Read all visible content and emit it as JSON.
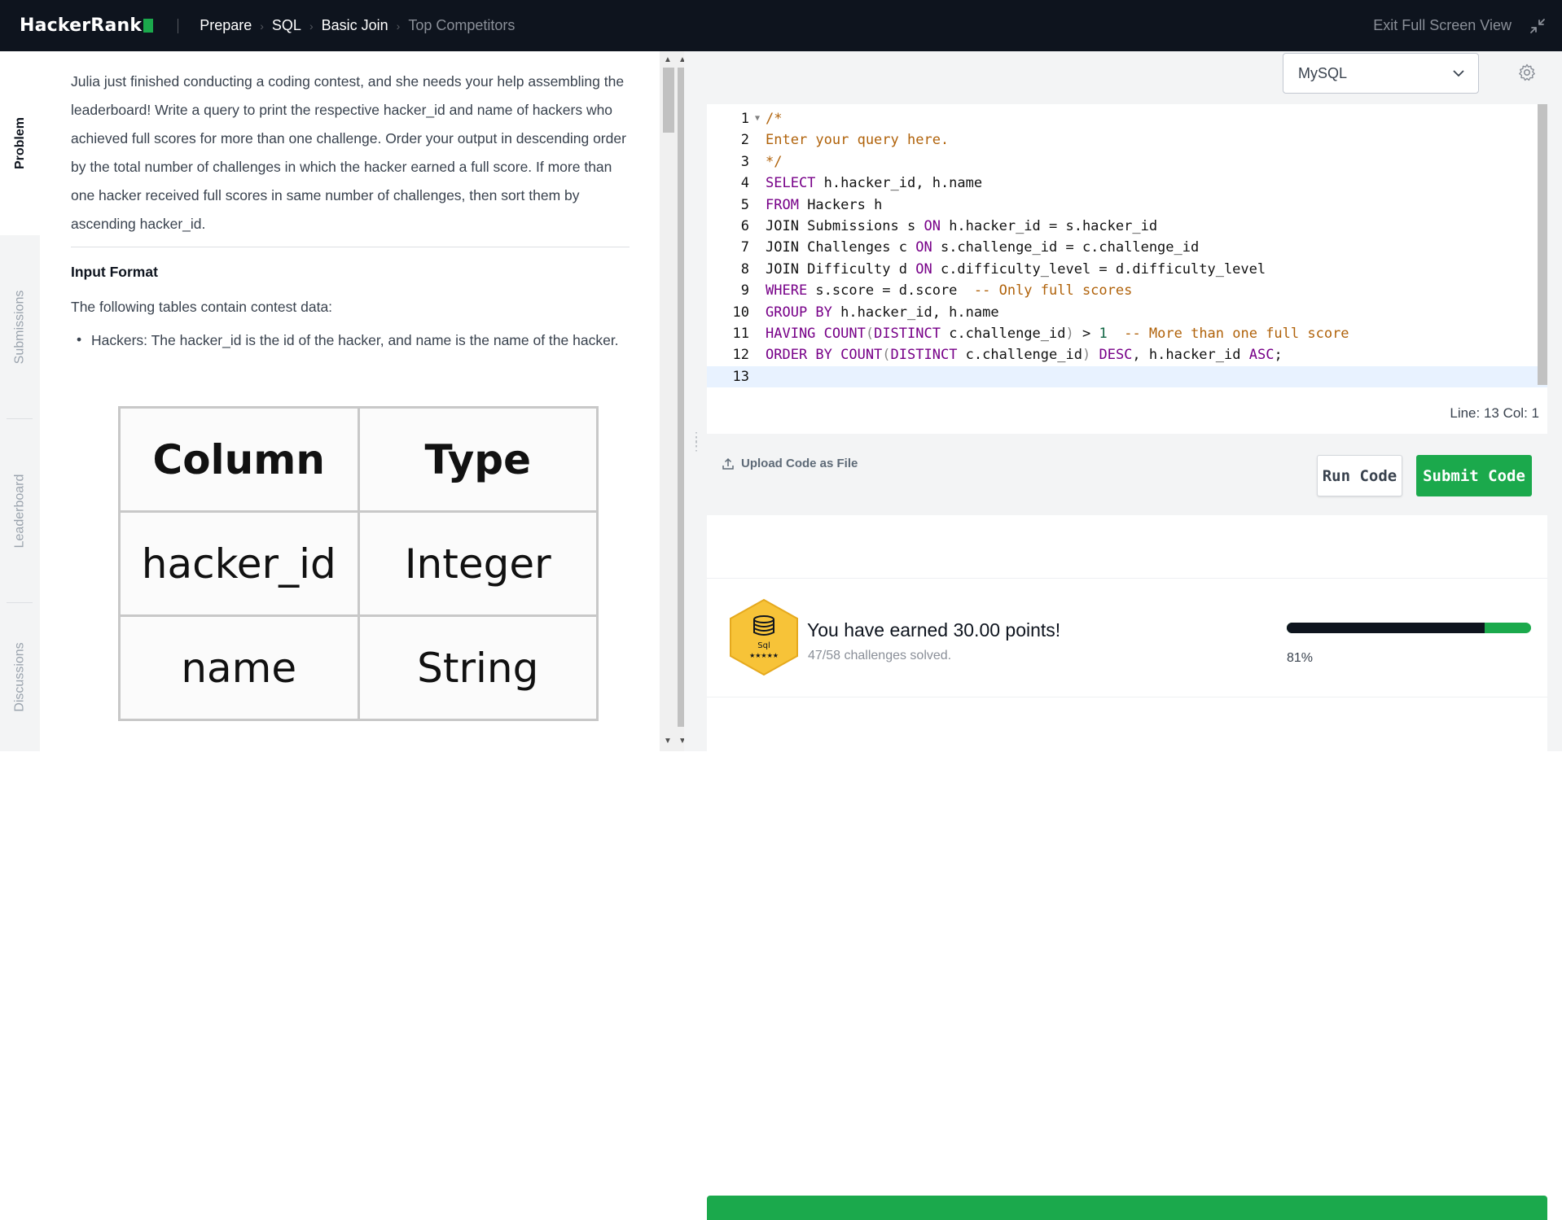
{
  "topbar": {
    "logo": "HackerRank",
    "breadcrumbs": [
      "Prepare",
      "SQL",
      "Basic Join",
      "Top Competitors"
    ],
    "exit_label": "Exit Full Screen View"
  },
  "rail": {
    "tabs": [
      "Problem",
      "Submissions",
      "Leaderboard",
      "Discussions"
    ],
    "active": "Problem"
  },
  "problem": {
    "statement_lines": [
      "Julia just finished conducting a coding contest, and she needs your help assembling the",
      "leaderboard! Write a query to print the respective hacker_id and name of hackers who",
      "achieved full scores for more than one challenge. Order your output in descending order",
      "by the total number of challenges in which the hacker earned a full score. If more than",
      "one hacker received full scores in same number of challenges, then sort them by",
      "ascending hacker_id."
    ],
    "input_format_heading": "Input Format",
    "tables_intro": "The following tables contain contest data:",
    "bullet_hackers": "Hackers: The hacker_id is the id of the hacker, and name is the name of the hacker.",
    "table": {
      "headers": [
        "Column",
        "Type"
      ],
      "rows": [
        [
          "hacker_id",
          "Integer"
        ],
        [
          "name",
          "String"
        ]
      ]
    }
  },
  "editor": {
    "language": "MySQL",
    "status": "Line: 13 Col: 1"
  },
  "actions": {
    "upload_label": "Upload Code as File",
    "run_label": "Run Code",
    "submit_label": "Submit Code"
  },
  "result": {
    "badge_label": "Sql",
    "badge_stars": "★★★★★",
    "earned": "You have earned 30.00 points!",
    "solved": "47/58 challenges solved.",
    "progress_percent": 81,
    "progress_label": "81%"
  },
  "colors": {
    "topbar_bg": "#0e141e",
    "accent_green": "#1ba94c",
    "badge_gold": "#f7c338"
  }
}
